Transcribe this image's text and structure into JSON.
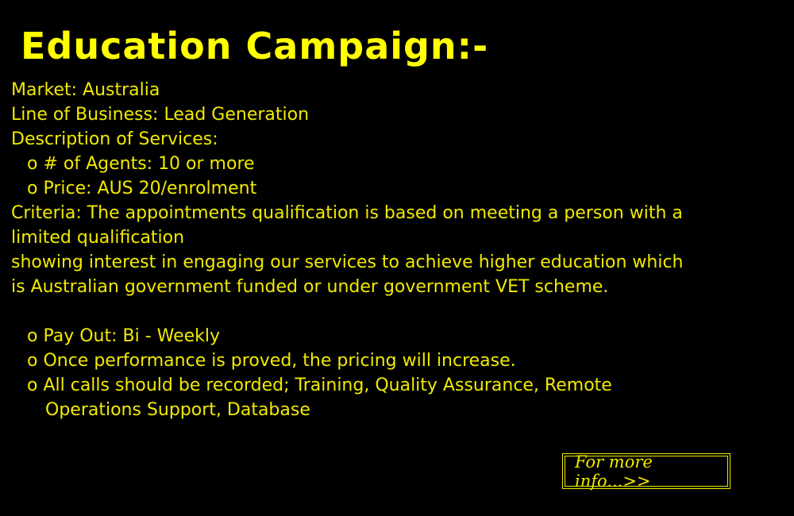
{
  "title": "Education Campaign:-",
  "lines": {
    "market": "Market: Australia",
    "line_of_business": "Line of Business: Lead Generation",
    "description_heading": "Description of Services:",
    "agents": "o # of Agents: 10 or more",
    "price": "o Price: AUS 20/enrolment",
    "criteria_1": "Criteria: The appointments qualification is based on meeting a person with a",
    "criteria_2": "limited qualification",
    "criteria_3": "showing interest in engaging our services to achieve higher education which",
    "criteria_4": "is Australian government funded or under government VET scheme.",
    "payout": "o Pay Out: Bi - Weekly",
    "performance": "o Once performance is proved, the pricing will increase.",
    "calls_1": "o All calls should be recorded; Training, Quality Assurance, Remote",
    "calls_2": "Operations Support, Database"
  },
  "more_info_label": "For more info...>>",
  "colors": {
    "background": "#000000",
    "text": "#f2ea00",
    "title": "#ffff00"
  }
}
